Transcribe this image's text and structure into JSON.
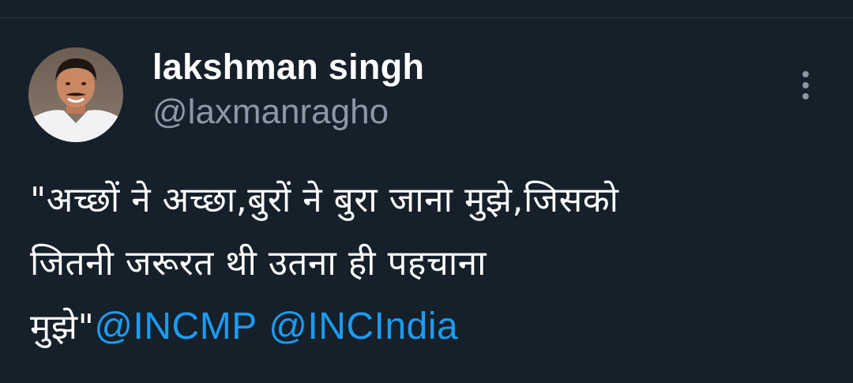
{
  "tweet": {
    "author": {
      "display_name": "lakshman singh",
      "handle": "@laxmanragho",
      "avatar_icon": "profile-photo"
    },
    "more_icon": "more-vertical-icon",
    "text_lines": [
      "\"अच्छों ने अच्छा,बुरों ने बुरा जाना मुझे,जिसको",
      "जितनी जरूरत थी उतना ही पहचाना",
      "मुझे\""
    ],
    "mentions": [
      "@INCMP",
      "@INCIndia"
    ]
  },
  "colors": {
    "background": "#15202b",
    "text": "#ffffff",
    "secondary": "#8b98a5",
    "link": "#1d9bf0"
  }
}
